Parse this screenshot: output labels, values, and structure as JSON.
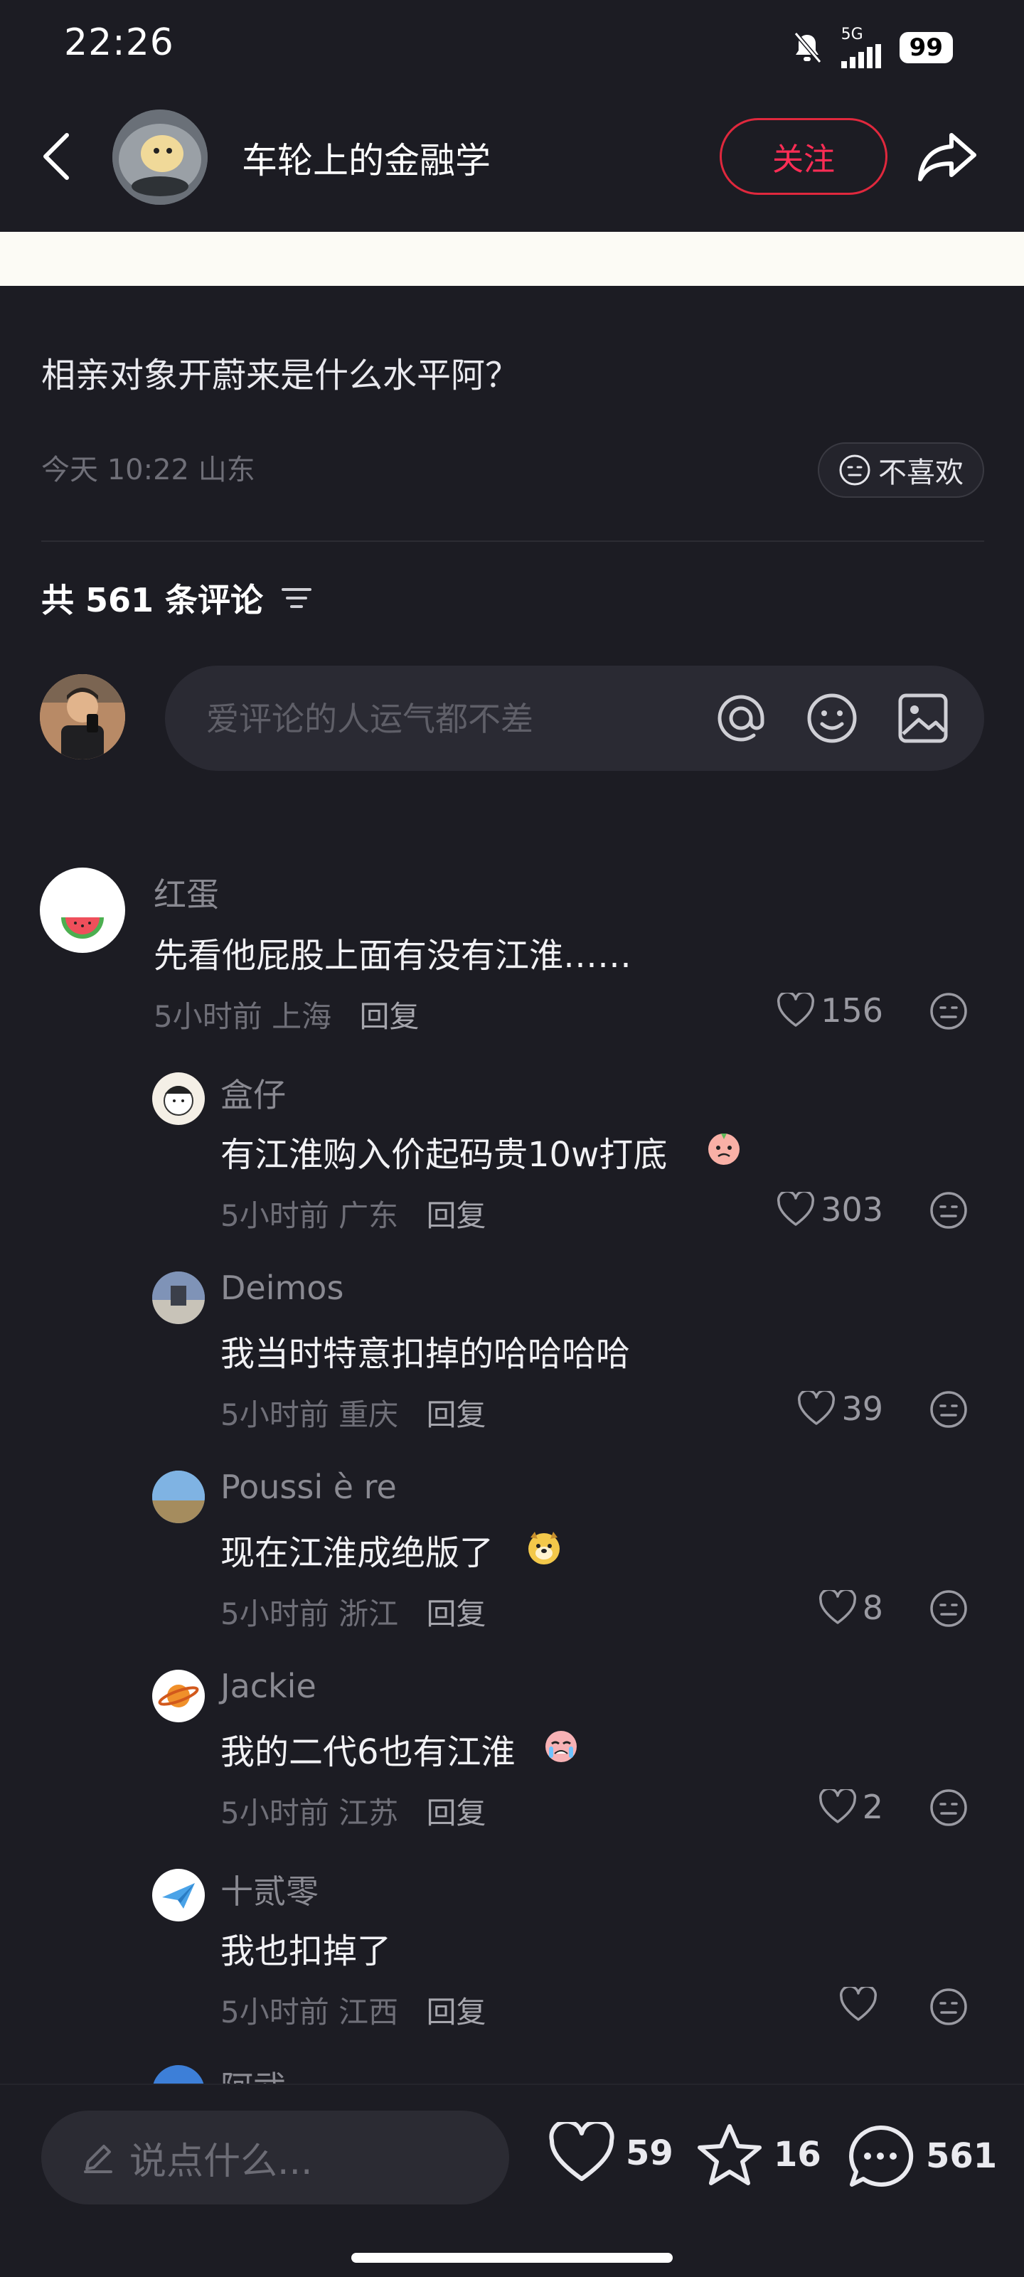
{
  "status_bar": {
    "time": "22:26",
    "network": "5G",
    "battery": "99"
  },
  "header": {
    "title": "车轮上的金融学",
    "follow_label": "关注"
  },
  "post": {
    "title": "相亲对象开蔚来是什么水平阿？",
    "meta": "今天 10:22 山东",
    "dislike_label": "不喜欢"
  },
  "comments_section": {
    "heading": "共 561 条评论",
    "input_placeholder": "爱评论的人运气都不差"
  },
  "comments": [
    {
      "name": "红蛋",
      "text": "先看他屁股上面有没有江淮……",
      "time": "5小时前",
      "location": "上海",
      "reply": "回复",
      "likes": "156"
    },
    {
      "name": "盒仔",
      "text": "有江淮购入价起码贵10w打底",
      "time": "5小时前",
      "location": "广东",
      "reply": "回复",
      "likes": "303"
    },
    {
      "name": "Deimos",
      "text": "我当时特意扣掉的哈哈哈哈",
      "time": "5小时前",
      "location": "重庆",
      "reply": "回复",
      "likes": "39"
    },
    {
      "name": "Poussi è re",
      "text": "现在江淮成绝版了",
      "time": "5小时前",
      "location": "浙江",
      "reply": "回复",
      "likes": "8"
    },
    {
      "name": "Jackie",
      "text": "我的二代6也有江淮",
      "time": "5小时前",
      "location": "江苏",
      "reply": "回复",
      "likes": "2"
    },
    {
      "name": "十贰零",
      "text": "我也扣掉了",
      "time": "5小时前",
      "location": "江西",
      "reply": "回复",
      "likes": ""
    },
    {
      "name": "阿武"
    }
  ],
  "bottom_bar": {
    "say_placeholder": "说点什么...",
    "likes": "59",
    "stars": "16",
    "comments": "561"
  },
  "colors": {
    "accent": "#ff2d55",
    "background": "#1c1c23",
    "card": "#2a2a33"
  }
}
